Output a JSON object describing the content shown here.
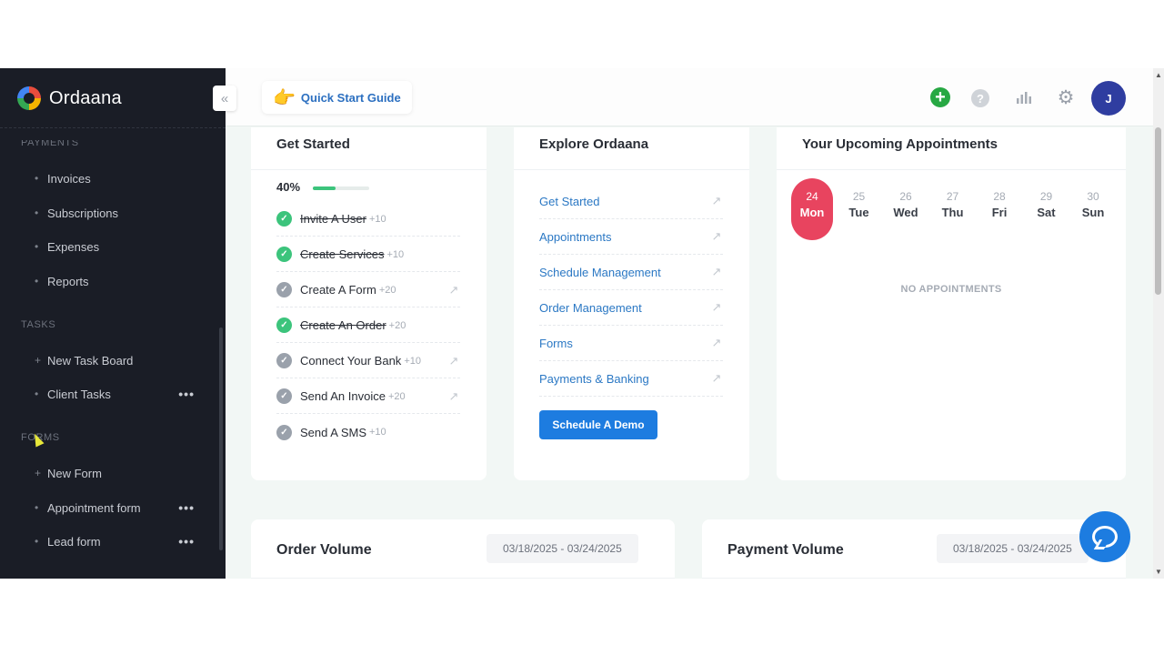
{
  "brand": {
    "name": "Ordaana"
  },
  "sidebar": {
    "collapse_icon": "«",
    "sections": [
      {
        "title": "PAYMENTS",
        "items": [
          {
            "label": "Invoices",
            "bullet": "•"
          },
          {
            "label": "Subscriptions",
            "bullet": "•"
          },
          {
            "label": "Expenses",
            "bullet": "•"
          },
          {
            "label": "Reports",
            "bullet": "•"
          }
        ]
      },
      {
        "title": "TASKS",
        "items": [
          {
            "label": "New Task Board",
            "bullet": "+"
          },
          {
            "label": "Client Tasks",
            "bullet": "•",
            "more": "•••"
          }
        ]
      },
      {
        "title": "FORMS",
        "items": [
          {
            "label": "New Form",
            "bullet": "+"
          },
          {
            "label": "Appointment form",
            "bullet": "•",
            "more": "•••"
          },
          {
            "label": "Lead form",
            "bullet": "•",
            "more": "•••"
          }
        ]
      }
    ]
  },
  "topbar": {
    "quick_start_label": "Quick Start Guide",
    "quick_start_icon": "👉",
    "plus_icon": "+",
    "help_icon": "?",
    "gear_icon": "⚙",
    "avatar_initial": "J"
  },
  "get_started": {
    "title": "Get Started",
    "progress_label": "40%",
    "progress_value": 0.4,
    "tasks": [
      {
        "label": "Invite A User",
        "points": "+10",
        "done": true
      },
      {
        "label": "Create Services",
        "points": "+10",
        "done": true
      },
      {
        "label": "Create A Form",
        "points": "+20",
        "done": false
      },
      {
        "label": "Create An Order",
        "points": "+20",
        "done": true
      },
      {
        "label": "Connect Your Bank",
        "points": "+10",
        "done": false
      },
      {
        "label": "Send An Invoice",
        "points": "+20",
        "done": false
      },
      {
        "label": "Send A SMS",
        "points": "+10",
        "done": false
      }
    ]
  },
  "explore": {
    "title": "Explore Ordaana",
    "links": [
      "Get Started",
      "Appointments",
      "Schedule Management",
      "Order Management",
      "Forms",
      "Payments & Banking"
    ],
    "demo_button": "Schedule A Demo",
    "link_icon": "↗"
  },
  "appointments": {
    "title": "Your Upcoming Appointments",
    "days": [
      {
        "num": "24",
        "name": "Mon",
        "active": true
      },
      {
        "num": "25",
        "name": "Tue",
        "active": false
      },
      {
        "num": "26",
        "name": "Wed",
        "active": false
      },
      {
        "num": "27",
        "name": "Thu",
        "active": false
      },
      {
        "num": "28",
        "name": "Fri",
        "active": false
      },
      {
        "num": "29",
        "name": "Sat",
        "active": false
      },
      {
        "num": "30",
        "name": "Sun",
        "active": false
      }
    ],
    "empty_text": "NO APPOINTMENTS"
  },
  "order_volume": {
    "title": "Order Volume",
    "date_range": "03/18/2025 - 03/24/2025"
  },
  "payment_volume": {
    "title": "Payment Volume",
    "date_range": "03/18/2025 - 03/24/2025"
  },
  "colors": {
    "accent": "#1d7ce0",
    "success": "#3cc47c",
    "active_day": "#e8445f",
    "sidebar_bg": "#1a1d26"
  }
}
